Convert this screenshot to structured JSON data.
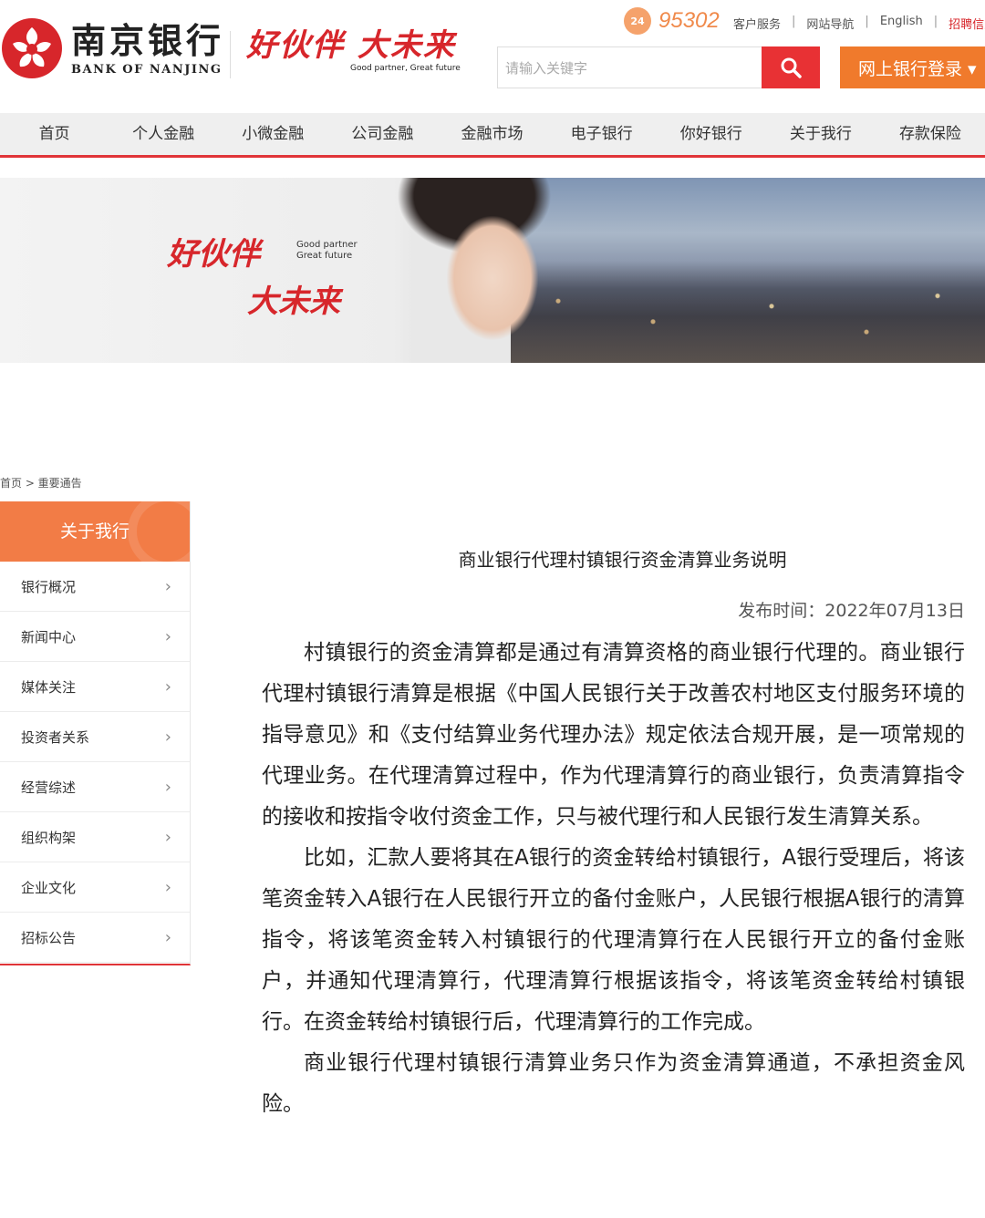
{
  "header": {
    "logo_cn": "南京银行",
    "logo_en": "BANK OF NANJING",
    "slogan_cn": "好伙伴 大未来",
    "slogan_en": "Good partner, Great future",
    "hotline_badge": "24",
    "hotline": "95302",
    "top_links": [
      "客户服务",
      "网站导航",
      "English",
      "招聘信息"
    ],
    "search_placeholder": "请输入关键字",
    "login_label": "网上银行登录 ▾"
  },
  "nav": [
    "首页",
    "个人金融",
    "小微金融",
    "公司金融",
    "金融市场",
    "电子银行",
    "你好银行",
    "关于我行",
    "存款保险"
  ],
  "banner": {
    "slogan_line1": "好伙伴",
    "slogan_line2": "大未来",
    "en_line1": "Good partner",
    "en_line2": "Great future"
  },
  "breadcrumb": "首页 > 重要通告",
  "sidebar": {
    "title": "关于我行",
    "items": [
      "银行概况",
      "新闻中心",
      "媒体关注",
      "投资者关系",
      "经营综述",
      "组织构架",
      "企业文化",
      "招标公告"
    ]
  },
  "article": {
    "title": "商业银行代理村镇银行资金清算业务说明",
    "pubtime": "发布时间：2022年07月13日",
    "paragraphs": [
      "村镇银行的资金清算都是通过有清算资格的商业银行代理的。商业银行代理村镇银行清算是根据《中国人民银行关于改善农村地区支付服务环境的指导意见》和《支付结算业务代理办法》规定依法合规开展，是一项常规的代理业务。在代理清算过程中，作为代理清算行的商业银行，负责清算指令的接收和按指令收付资金工作，只与被代理行和人民银行发生清算关系。",
      "比如，汇款人要将其在A银行的资金转给村镇银行，A银行受理后，将该笔资金转入A银行在人民银行开立的备付金账户，人民银行根据A银行的清算指令，将该笔资金转入村镇银行的代理清算行在人民银行开立的备付金账户，并通知代理清算行，代理清算行根据该指令，将该笔资金转给村镇银行。在资金转给村镇银行后，代理清算行的工作完成。",
      "商业银行代理村镇银行清算业务只作为资金清算通道，不承担资金风险。"
    ]
  },
  "colors": {
    "brand_red": "#d7262b",
    "accent_orange": "#f07a2c",
    "search_red": "#e83134"
  }
}
